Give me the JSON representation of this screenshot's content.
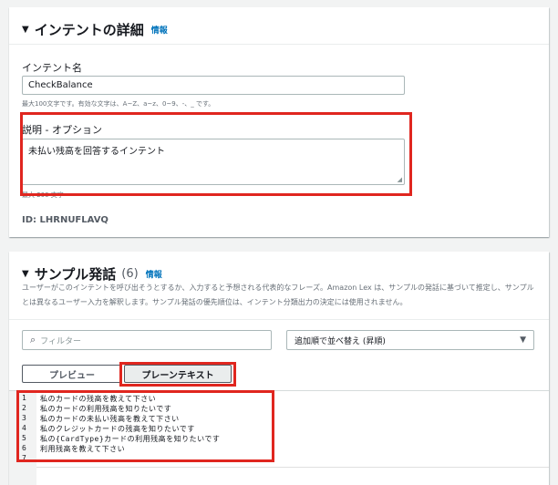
{
  "details": {
    "title": "インテントの詳細",
    "info": "情報",
    "name_label": "インテント名",
    "name_value": "CheckBalance",
    "name_hint": "最大100文字です。有効な文字は、A~Z、a~z、0~9、-、_ です。",
    "desc_label": "説明 - オプション",
    "desc_value": "未払い残高を回答するインテント",
    "desc_hint": "最大 200 文字",
    "id_text": "ID: LHRNUFLAVQ"
  },
  "utterances": {
    "title": "サンプル発話",
    "count": "(6)",
    "info": "情報",
    "description": "ユーザーがこのインテントを呼び出そうとするか、入力すると予想される代表的なフレーズ。Amazon Lex は、サンプルの発話に基づいて推定し、サンプルとは異なるユーザー入力を解釈します。サンプル発話の優先順位は、インテント分類出力の決定には使用されません。",
    "filter_placeholder": "フィルター",
    "sort_label": "追加順で並べ替え (昇順)",
    "tabs": [
      "プレビュー",
      "プレーンテキスト"
    ],
    "lines": [
      {
        "num": "1",
        "text": "私のカードの残高を教えて下さい"
      },
      {
        "num": "2",
        "text": "私のカードの利用残高を知りたいです"
      },
      {
        "num": "3",
        "text": "私のカードの未払い残高を教えて下さい"
      },
      {
        "num": "4",
        "text": "私のクレジットカードの残高を知りたいです"
      },
      {
        "num": "5",
        "text": "私の{CardType}カードの利用残高を知りたいです"
      },
      {
        "num": "6",
        "text": "利用残高を教えて下さい"
      },
      {
        "num": "7",
        "text": ""
      }
    ]
  },
  "colors": {
    "highlight": "#e0261f",
    "link": "#0073bb"
  },
  "icons": [
    "caret-down-icon",
    "search-icon",
    "select-caret-icon",
    "resize-grip-icon"
  ]
}
